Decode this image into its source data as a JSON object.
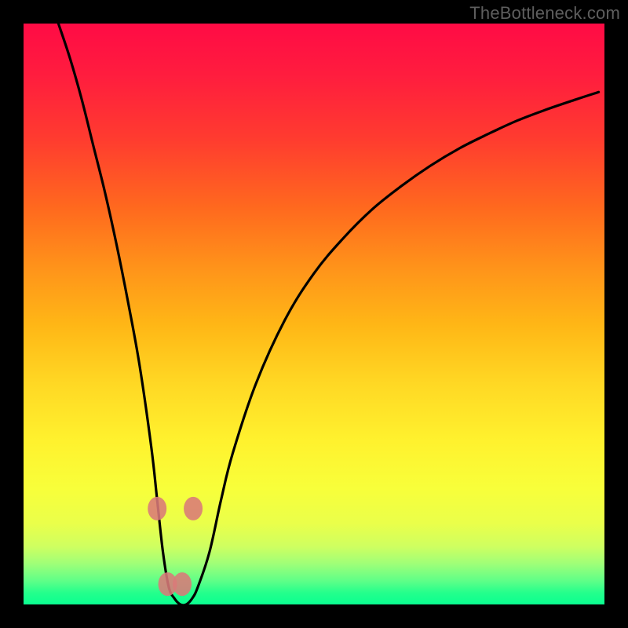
{
  "attribution": "TheBottleneck.com",
  "chart_data": {
    "type": "line",
    "title": "",
    "xlabel": "",
    "ylabel": "",
    "xlim": [
      0,
      100
    ],
    "ylim": [
      0,
      100
    ],
    "series": [
      {
        "name": "bottleneck-curve",
        "x": [
          6,
          8,
          10,
          12,
          14,
          16,
          18,
          20,
          22,
          23,
          24,
          25,
          26,
          27,
          28,
          29,
          30,
          32,
          34,
          36,
          40,
          45,
          50,
          55,
          60,
          65,
          70,
          75,
          80,
          85,
          90,
          95,
          99
        ],
        "y": [
          100,
          94,
          87,
          79,
          71,
          62,
          52,
          41,
          27,
          18,
          9,
          3,
          1,
          0,
          0,
          1,
          3,
          9,
          18,
          26,
          38,
          49,
          57,
          63,
          68,
          72,
          75.5,
          78.5,
          81,
          83.3,
          85.2,
          86.9,
          88.2
        ]
      }
    ],
    "markers": {
      "name": "highlight-dots",
      "x": [
        23.0,
        24.8,
        27.3,
        29.2
      ],
      "y": [
        16.5,
        3.5,
        3.5,
        16.5
      ]
    },
    "gradient_stops": [
      {
        "pos": 0,
        "color": "#ff0b45"
      },
      {
        "pos": 50,
        "color": "#ffb716"
      },
      {
        "pos": 80,
        "color": "#f8ff3a"
      },
      {
        "pos": 100,
        "color": "#0aff90"
      }
    ]
  }
}
